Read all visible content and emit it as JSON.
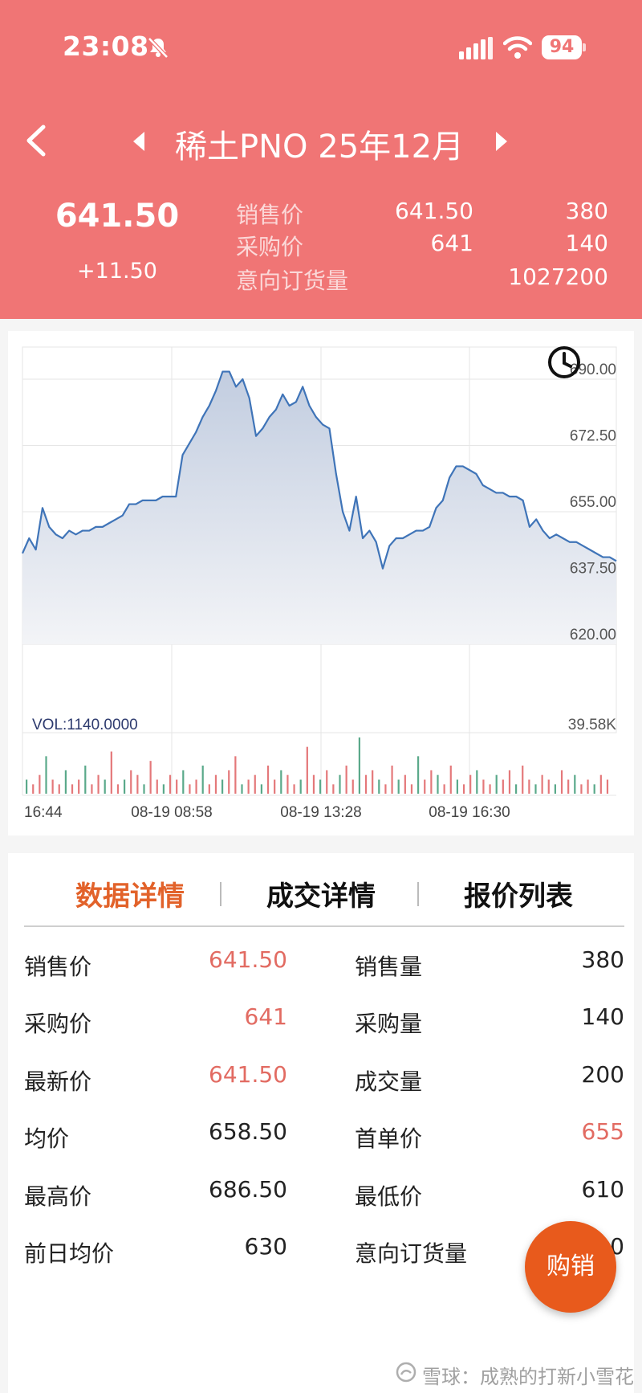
{
  "status": {
    "time": "23:08",
    "battery": "94"
  },
  "header": {
    "title": "稀土PNO  25年12月",
    "price": "641.50",
    "change": "+11.50",
    "quotes": [
      {
        "label": "销售价",
        "value1": "641.50",
        "value2": "380"
      },
      {
        "label": "采购价",
        "value1": "641",
        "value2": "140"
      },
      {
        "label": "意向订货量",
        "value1": "",
        "value2": "1027200"
      }
    ]
  },
  "chart_data": {
    "type": "line",
    "ylim": [
      620,
      690
    ],
    "y_ticks": [
      "690.00",
      "672.50",
      "655.00",
      "637.50",
      "620.00"
    ],
    "x_ticks": [
      "16:44",
      "08-19 08:58",
      "08-19 13:28",
      "08-19 16:30"
    ],
    "volume_label": "VOL:1140.0000",
    "volume_max_label": "39.58K",
    "price_series": [
      644,
      648,
      645,
      656,
      651,
      649,
      648,
      650,
      649,
      650,
      650,
      651,
      651,
      652,
      653,
      654,
      657,
      657,
      658,
      658,
      658,
      659,
      659,
      659,
      670,
      673,
      676,
      680,
      683,
      687,
      692,
      692,
      688,
      690,
      685,
      675,
      677,
      680,
      682,
      686,
      683,
      684,
      688,
      683,
      680,
      678,
      677,
      665,
      655,
      650,
      659,
      648,
      650,
      647,
      640,
      646,
      648,
      648,
      649,
      650,
      650,
      651,
      656,
      658,
      664,
      667,
      667,
      666,
      665,
      662,
      661,
      660,
      660,
      659,
      659,
      658,
      651,
      653,
      650,
      648,
      649,
      648,
      647,
      647,
      646,
      645,
      644,
      643,
      643,
      642
    ],
    "volume_series": [
      3,
      2,
      4,
      8,
      3,
      2,
      5,
      2,
      3,
      6,
      2,
      4,
      3,
      9,
      2,
      3,
      5,
      4,
      2,
      7,
      3,
      2,
      4,
      3,
      5,
      2,
      3,
      6,
      2,
      4,
      3,
      5,
      8,
      2,
      3,
      4,
      2,
      6,
      3,
      5,
      4,
      2,
      3,
      10,
      4,
      3,
      5,
      2,
      4,
      6,
      3,
      12,
      4,
      5,
      3,
      2,
      6,
      3,
      4,
      2,
      8,
      3,
      5,
      4,
      2,
      6,
      3,
      2,
      4,
      5,
      3,
      2,
      4,
      3,
      5,
      2,
      6,
      3,
      2,
      4,
      3,
      2,
      5,
      3,
      4,
      2,
      3,
      2,
      4,
      3
    ]
  },
  "tabs": [
    "数据详情",
    "成交详情",
    "报价列表"
  ],
  "details": {
    "left": [
      {
        "label": "销售价",
        "value": "641.50",
        "highlight": true
      },
      {
        "label": "采购价",
        "value": "641",
        "highlight": true
      },
      {
        "label": "最新价",
        "value": "641.50",
        "highlight": true
      },
      {
        "label": "均价",
        "value": "658.50",
        "highlight": false
      },
      {
        "label": "最高价",
        "value": "686.50",
        "highlight": false
      },
      {
        "label": "前日均价",
        "value": "630",
        "highlight": false
      }
    ],
    "right": [
      {
        "label": "销售量",
        "value": "380",
        "highlight": false
      },
      {
        "label": "采购量",
        "value": "140",
        "highlight": false
      },
      {
        "label": "成交量",
        "value": "200",
        "highlight": false
      },
      {
        "label": "首单价",
        "value": "655",
        "highlight": true
      },
      {
        "label": "最低价",
        "value": "610",
        "highlight": false
      },
      {
        "label": "意向订货量",
        "value": "0",
        "highlight": false
      }
    ]
  },
  "fab_label": "购销",
  "watermark": "雪球：成熟的打新小雪花",
  "colors": {
    "header": "#f07575",
    "accent": "#e2622a",
    "line": "#3f74b8",
    "fab": "#e85a1c"
  }
}
